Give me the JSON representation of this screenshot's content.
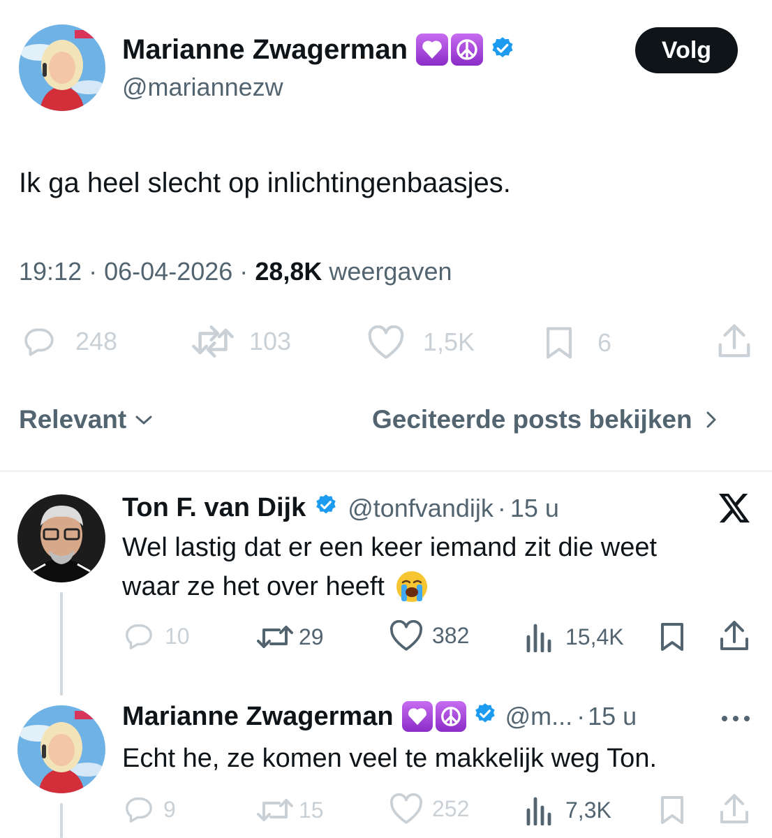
{
  "main_post": {
    "author_name": "Marianne Zwagerman",
    "author_handle": "@mariannezw",
    "badges": [
      "purple-heart",
      "peace-symbol"
    ],
    "follow_label": "Volg",
    "text": "Ik ga heel slecht op inlichtingenbaasjes.",
    "time": "19:12",
    "date": "06-04-2026",
    "views_count": "28,8K",
    "views_label": "weergaven",
    "separator": "·",
    "actions": {
      "replies": "248",
      "reposts": "103",
      "likes": "1,5K",
      "bookmarks": "6"
    }
  },
  "sort_bar": {
    "relevant_label": "Relevant",
    "quoted_label": "Geciteerde posts bekijken"
  },
  "replies": [
    {
      "author_name": "Ton F. van Dijk",
      "author_handle": "@tonfvandijk",
      "age": "15 u",
      "separator": "·",
      "text_line1": "Wel lastig dat er een keer iemand zit die weet",
      "text_line2": "waar ze het over heeft",
      "emoji": "loudly-crying-face",
      "actions": {
        "replies": "10",
        "reposts": "29",
        "likes": "382",
        "views": "15,4K"
      }
    },
    {
      "author_name": "Marianne Zwagerman",
      "author_handle": "@m...",
      "age": "15 u",
      "separator": "·",
      "text": "Echt he, ze komen veel te makkelijk weg Ton.",
      "actions": {
        "replies": "9",
        "reposts": "15",
        "likes": "252",
        "views": "7,3K"
      }
    }
  ],
  "colors": {
    "text_primary": "#0f1419",
    "text_secondary": "#536471",
    "verified_blue": "#1d9bf0",
    "badge_purple": "#a24de0",
    "action_faded": "#c9d0d6"
  }
}
